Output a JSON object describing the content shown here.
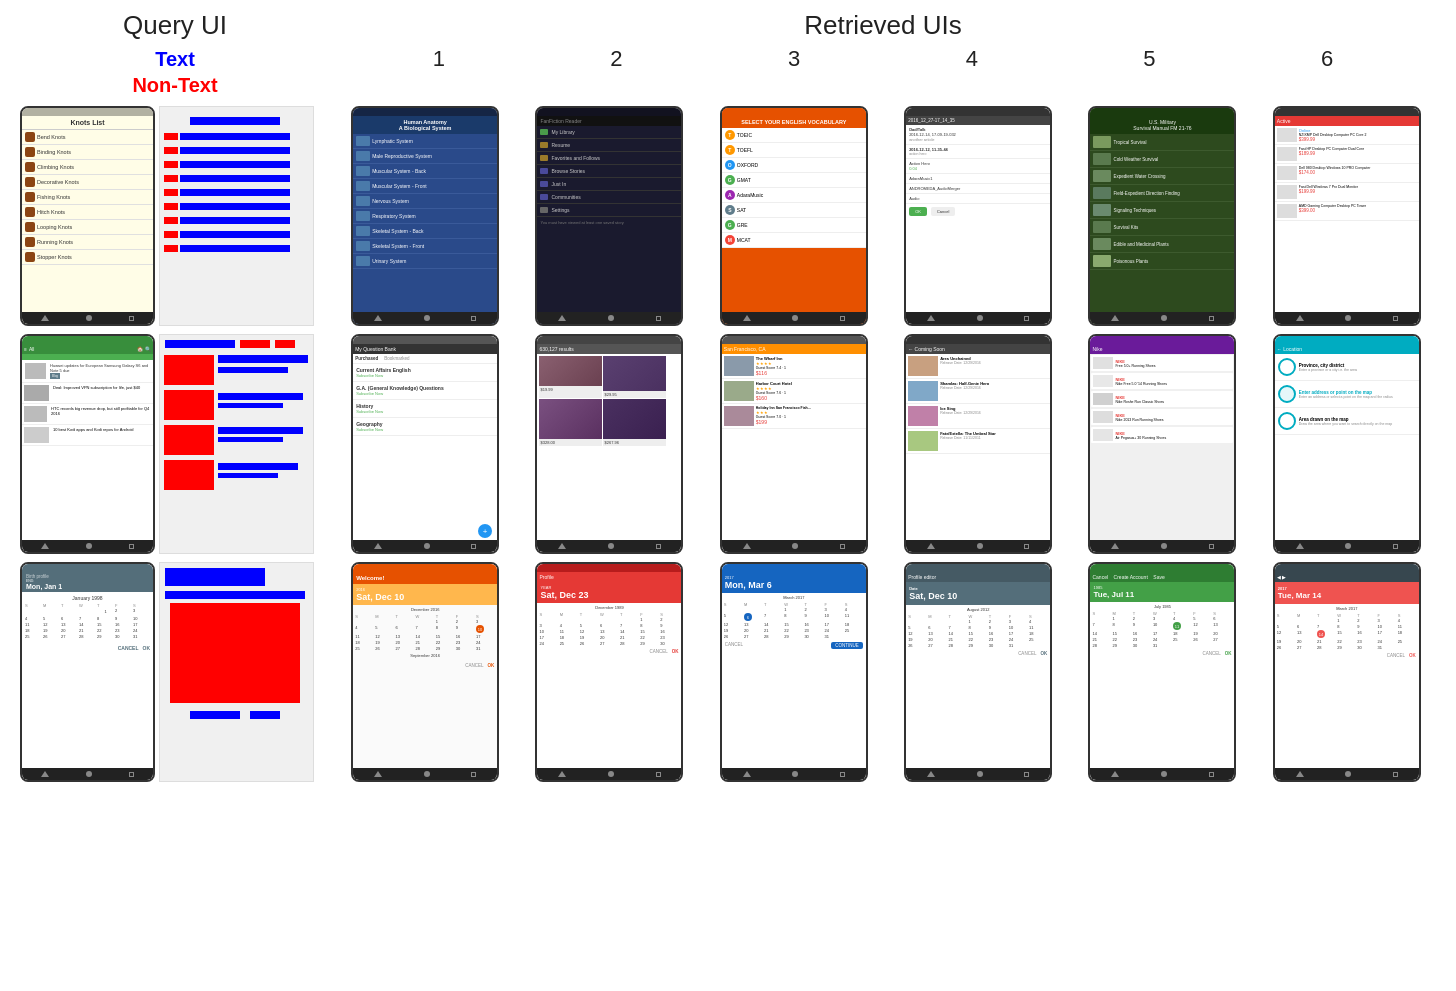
{
  "header": {
    "query_ui_label": "Query UI",
    "retrieved_uis_label": "Retrieved UIs",
    "text_label": "Text",
    "nontext_label": "Non-Text",
    "numbers": [
      "1",
      "2",
      "3",
      "4",
      "5",
      "6"
    ]
  },
  "rows": [
    {
      "id": "row1",
      "query": {
        "screen": "knots_list",
        "title": "Knots List",
        "items": [
          "Bend Knots",
          "Binding Knots",
          "Climbing Knots",
          "Decorative Knots",
          "Fishing Knots",
          "Hitch Knots",
          "Looping Knots",
          "Running Knots",
          "Stopper Knots"
        ]
      }
    },
    {
      "id": "row2",
      "query": {
        "screen": "news_feed"
      }
    },
    {
      "id": "row3",
      "query": {
        "screen": "birth_profile",
        "date": "Mon, Jan 1"
      }
    }
  ]
}
